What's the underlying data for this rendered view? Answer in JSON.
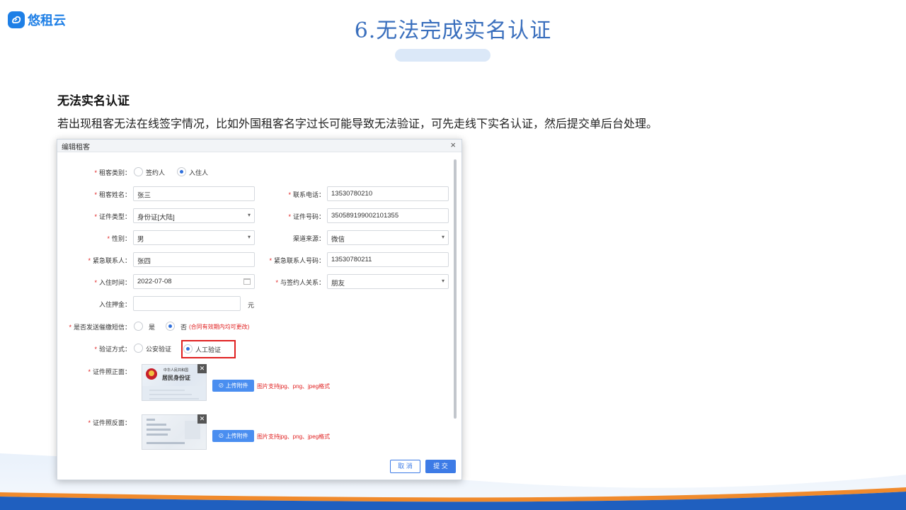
{
  "logo": {
    "text": "悠租云"
  },
  "slide": {
    "title": "6.无法完成实名认证",
    "heading": "无法实名认证",
    "description": "若出现租客无法在线签字情况，比如外国租客名字过长可能导致无法验证，可先走线下实名认证，然后提交单后台处理。"
  },
  "dialog": {
    "title": "编辑租客",
    "close_symbol": "×",
    "tenant_type": {
      "label": "租客类别：",
      "options": [
        "签约人",
        "入住人"
      ],
      "selected": "入住人"
    },
    "tenant_name": {
      "label": "租客姓名：",
      "value": "张三"
    },
    "phone": {
      "label": "联系电话：",
      "value": "13530780210"
    },
    "id_type": {
      "label": "证件类型：",
      "value": "身份证[大陆]"
    },
    "id_number": {
      "label": "证件号码：",
      "value": "350589199002101355"
    },
    "gender": {
      "label": "性别：",
      "value": "男"
    },
    "channel": {
      "label": "渠道来源：",
      "value": "微信"
    },
    "emergency_contact": {
      "label": "紧急联系人：",
      "value": "张四"
    },
    "emergency_phone": {
      "label": "紧急联系人号码：",
      "value": "13530780211"
    },
    "checkin_date": {
      "label": "入住时间：",
      "value": "2022-07-08"
    },
    "relation": {
      "label": "与签约人关系：",
      "value": "朋友"
    },
    "deposit": {
      "label": "入住押金：",
      "value": "",
      "unit": "元"
    },
    "sms_reminder": {
      "label": "是否发送催缴短信：",
      "options": [
        "是",
        "否"
      ],
      "selected": "否",
      "hint": "(合同有效期内均可更改)"
    },
    "verify_method": {
      "label": "验证方式：",
      "options": [
        "公安验证",
        "人工验证"
      ],
      "selected": "人工验证"
    },
    "id_front": {
      "label": "证件照正面：",
      "card_title_small": "中华人民共和国",
      "card_title": "居民身份证",
      "upload_label": "上传附件",
      "hint": "图片支持jpg、png、jpeg格式"
    },
    "id_back": {
      "label": "证件照反面：",
      "upload_label": "上传附件",
      "hint": "图片支持jpg、png、jpeg格式"
    },
    "cancel_label": "取 消",
    "submit_label": "提 交"
  },
  "colors": {
    "accent": "#3d7be6",
    "required": "#e02020",
    "title_blue": "#3a6fbd",
    "wave_blue": "#1f5fbf",
    "wave_orange": "#f08a2c"
  },
  "icons": {
    "logo": "cloud-logo-icon",
    "close": "close-icon",
    "dropdown": "chevron-down-icon",
    "calendar": "calendar-icon",
    "upload": "paperclip-icon",
    "delete": "close-icon"
  }
}
